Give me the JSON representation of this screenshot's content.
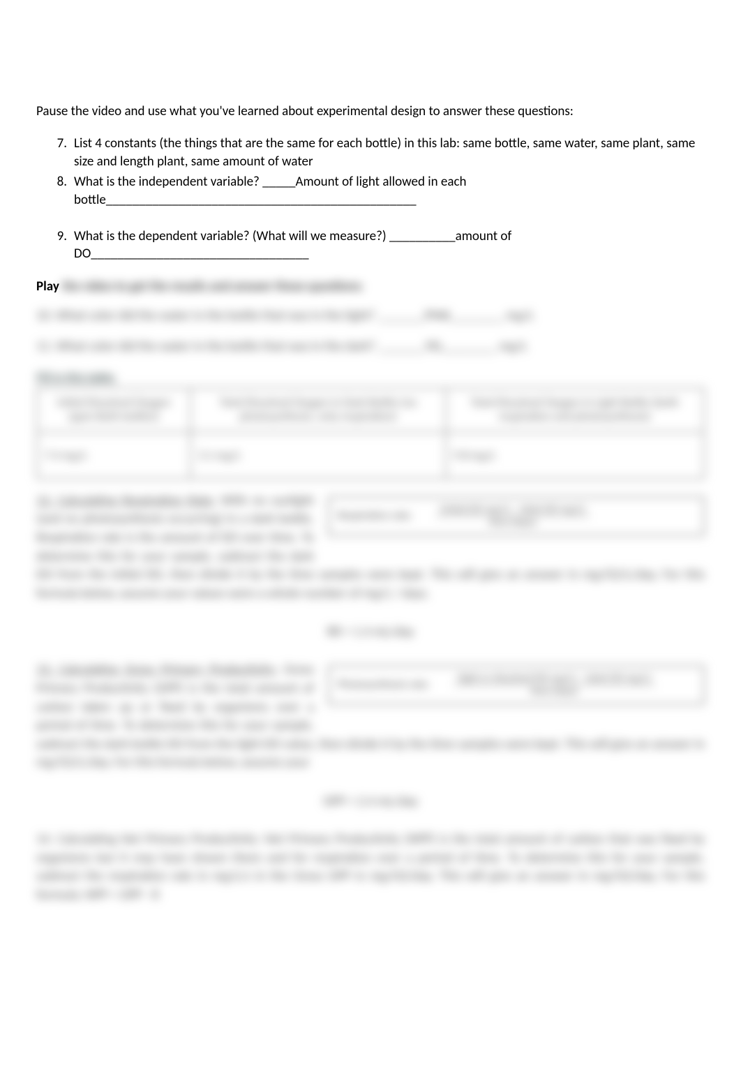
{
  "intro": "Pause the video and use what you've learned about experimental design to answer these questions:",
  "questions": {
    "q7": {
      "num": "7.",
      "text": "List 4 constants (the things that are the same for each bottle) in this lab: same bottle, same water, same plant, same size and length plant, same amount of water"
    },
    "q8": {
      "num": "8.",
      "text": "What is the independent variable? _____Amount of light allowed in each bottle_______________________________________________"
    },
    "q9": {
      "num": "9.",
      "text": "What is the dependent variable? (What will we measure?) __________amount of DO_________________________________"
    }
  },
  "play_label": "Play",
  "blurred": {
    "play_rest": " the video to get the results and answer these questions:",
    "line10": "10. What color did the water in the bottle that was in the light?  _______PINK________  mg/L",
    "line11": "11. What color did the water in the bottle that was in the dark?  _______YEL________  mg/L",
    "table_heading": "Fill in this table:",
    "table": {
      "headers": [
        "Initial Dissolved Oxygen (ppm Both bottles)",
        "Total Dissolved Oxygen in Dark Bottle (no photosynthesis, only respiration)",
        "Total Dissolved Oxygen in Light Bottle (both respiration and photosynthesis)"
      ],
      "row": [
        "7.4 mg/L",
        "3.1 mg/L",
        "9.8 mg/L"
      ]
    },
    "para12_head": "12. Calculating Respiration Rate:",
    "para12": "  With no sunlight (and no photosynthesis occurring) in a dark bottle, Respiration rate is the amount of DO over time. To determine this for your sample, subtract the dark DO from the initial DO, then divide it by the time samples were kept. This will give an answer in mg/O2/L/day. For this formula below, assume your values were a whole number of mg/L / days.",
    "formula12_title": "Respiration rate:",
    "formula12_top": "(initial DO mg/L) – (dark DO mg/L)",
    "formula12_bot": "time (days)",
    "eq12": "RR =  1.4 mL/day",
    "para13_head": "13. Calculating Gross Primary Productivity:",
    "para13": "  Gross Primary Productivity (GPP) is the total amount of carbon taken up or fixed by organisms over a period of time. To determine this for your sample, subtract the dark bottle DO from the light DO value, then divide it by the time samples were kept. This will give an answer in mg/O2/L/day. For this formula below, assume your",
    "formula13_title": "Photosynthesis rate:",
    "formula13_top": "(light or dissolved DO mg/L) – (dark DO mg/L)",
    "formula13_bot": "time (days)",
    "eq13": "GPP =  2.4 mL/day",
    "para14": "14. Calculating Net Primary Productivity: Net Primary Productivity (NPP) is the total amount of carbon that was fixed by organisms but it may have shown there and for respiration over a period of time.  To determine this for your sample, subtract the respiration rate in mg/L/s in the Gross GPP in mg/O2/day. This will give an answer in mg/O2/day. For this formula: NPP = GPP - R"
  }
}
